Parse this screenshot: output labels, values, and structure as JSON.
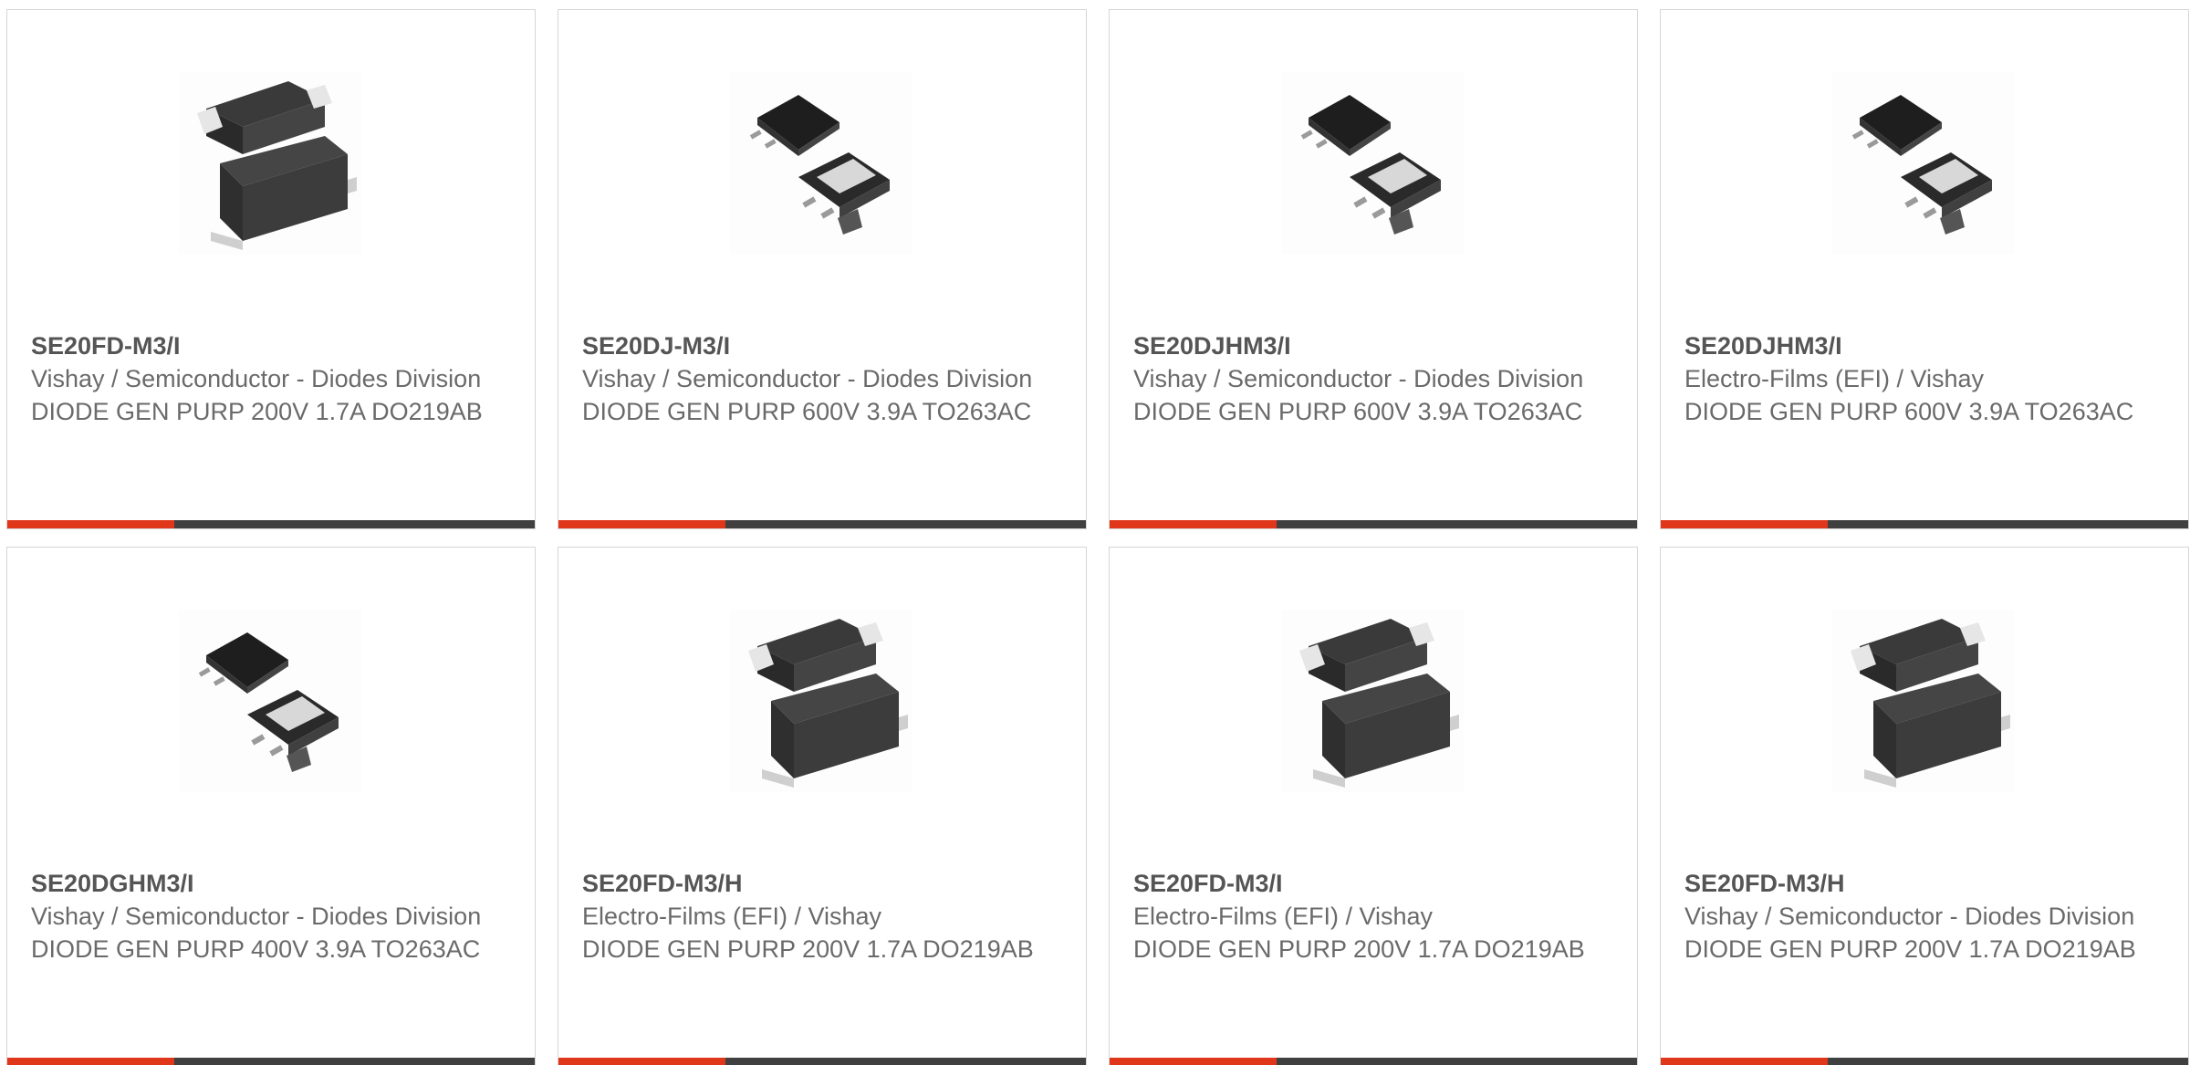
{
  "products": [
    {
      "part_number": "SE20FD-M3/I",
      "manufacturer": "Vishay / Semiconductor - Diodes Division",
      "description": "DIODE GEN PURP 200V 1.7A DO219AB",
      "package_icon": "do219ab-package-icon"
    },
    {
      "part_number": "SE20DJ-M3/I",
      "manufacturer": "Vishay / Semiconductor - Diodes Division",
      "description": "DIODE GEN PURP 600V 3.9A TO263AC",
      "package_icon": "to263ac-package-icon"
    },
    {
      "part_number": "SE20DJHM3/I",
      "manufacturer": "Vishay / Semiconductor - Diodes Division",
      "description": "DIODE GEN PURP 600V 3.9A TO263AC",
      "package_icon": "to263ac-package-icon"
    },
    {
      "part_number": "SE20DJHM3/I",
      "manufacturer": "Electro-Films (EFI) / Vishay",
      "description": "DIODE GEN PURP 600V 3.9A TO263AC",
      "package_icon": "to263ac-package-icon"
    },
    {
      "part_number": "SE20DGHM3/I",
      "manufacturer": "Vishay / Semiconductor - Diodes Division",
      "description": "DIODE GEN PURP 400V 3.9A TO263AC",
      "package_icon": "to263ac-package-icon"
    },
    {
      "part_number": "SE20FD-M3/H",
      "manufacturer": "Electro-Films (EFI) / Vishay",
      "description": "DIODE GEN PURP 200V 1.7A DO219AB",
      "package_icon": "do219ab-package-icon"
    },
    {
      "part_number": "SE20FD-M3/I",
      "manufacturer": "Electro-Films (EFI) / Vishay",
      "description": "DIODE GEN PURP 200V 1.7A DO219AB",
      "package_icon": "do219ab-package-icon"
    },
    {
      "part_number": "SE20FD-M3/H",
      "manufacturer": "Vishay / Semiconductor - Diodes Division",
      "description": "DIODE GEN PURP 200V 1.7A DO219AB",
      "package_icon": "do219ab-package-icon"
    }
  ],
  "colors": {
    "accent": "#e0361a",
    "bar": "#404040",
    "border": "#d6d6d6",
    "text": "#6a6a6a",
    "part_number": "#555555"
  }
}
